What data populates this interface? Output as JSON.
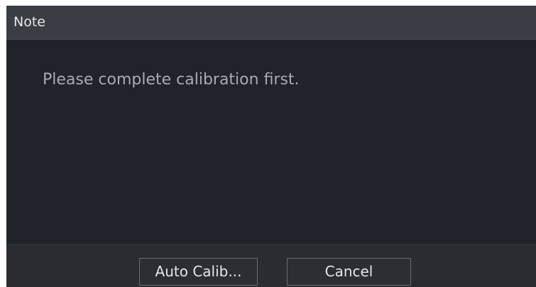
{
  "dialog": {
    "title": "Note",
    "message": "Please complete calibration first.",
    "buttons": {
      "auto_calib_label": "Auto Calib...",
      "cancel_label": "Cancel"
    }
  },
  "colors": {
    "dialog_background": "#21232a",
    "title_bar_background": "#3b3d44",
    "footer_background": "#2a2c32",
    "text_primary": "#e8e8ea",
    "text_secondary": "#a9abb0"
  }
}
